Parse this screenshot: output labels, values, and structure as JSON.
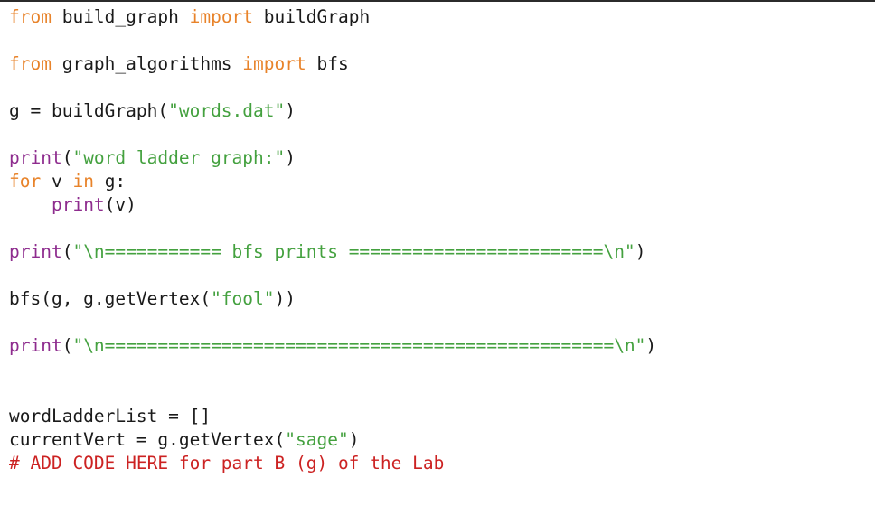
{
  "editor": {
    "name": "python-code-view",
    "language": "Python",
    "background_color": "#ffffff",
    "colors": {
      "keyword": "#e8832a",
      "builtin": "#8e2c8e",
      "string": "#44a13f",
      "comment": "#cc2222",
      "plain": "#1a1a1a",
      "border": "#2b2b2b"
    }
  },
  "code": {
    "lines": [
      {
        "index": 1,
        "text": "from build_graph import buildGraph",
        "tokens": [
          {
            "t": "from",
            "c": "kw"
          },
          {
            "t": " build_graph ",
            "c": "plain"
          },
          {
            "t": "import",
            "c": "kw"
          },
          {
            "t": " buildGraph",
            "c": "plain"
          }
        ]
      },
      {
        "index": 2,
        "text": "",
        "tokens": []
      },
      {
        "index": 3,
        "text": "from graph_algorithms import bfs",
        "tokens": [
          {
            "t": "from",
            "c": "kw"
          },
          {
            "t": " graph_algorithms ",
            "c": "plain"
          },
          {
            "t": "import",
            "c": "kw"
          },
          {
            "t": " bfs",
            "c": "plain"
          }
        ]
      },
      {
        "index": 4,
        "text": "",
        "tokens": []
      },
      {
        "index": 5,
        "text": "g = buildGraph(\"words.dat\")",
        "tokens": [
          {
            "t": "g = buildGraph(",
            "c": "plain"
          },
          {
            "t": "\"words.dat\"",
            "c": "str"
          },
          {
            "t": ")",
            "c": "plain"
          }
        ]
      },
      {
        "index": 6,
        "text": "",
        "tokens": []
      },
      {
        "index": 7,
        "text": "print(\"word ladder graph:\")",
        "tokens": [
          {
            "t": "print",
            "c": "builtin"
          },
          {
            "t": "(",
            "c": "plain"
          },
          {
            "t": "\"word ladder graph:\"",
            "c": "str"
          },
          {
            "t": ")",
            "c": "plain"
          }
        ]
      },
      {
        "index": 8,
        "text": "for v in g:",
        "tokens": [
          {
            "t": "for",
            "c": "kw"
          },
          {
            "t": " v ",
            "c": "plain"
          },
          {
            "t": "in",
            "c": "kw"
          },
          {
            "t": " g:",
            "c": "plain"
          }
        ]
      },
      {
        "index": 9,
        "text": "    print(v)",
        "tokens": [
          {
            "t": "    ",
            "c": "plain"
          },
          {
            "t": "print",
            "c": "builtin"
          },
          {
            "t": "(v)",
            "c": "plain"
          }
        ]
      },
      {
        "index": 10,
        "text": "",
        "tokens": []
      },
      {
        "index": 11,
        "text": "print(\"\\n=========== bfs prints ========================\\n\")",
        "tokens": [
          {
            "t": "print",
            "c": "builtin"
          },
          {
            "t": "(",
            "c": "plain"
          },
          {
            "t": "\"\\n=========== bfs prints ========================\\n\"",
            "c": "str"
          },
          {
            "t": ")",
            "c": "plain"
          }
        ]
      },
      {
        "index": 12,
        "text": "",
        "tokens": []
      },
      {
        "index": 13,
        "text": "bfs(g, g.getVertex(\"fool\"))",
        "tokens": [
          {
            "t": "bfs(g, g.getVertex(",
            "c": "plain"
          },
          {
            "t": "\"fool\"",
            "c": "str"
          },
          {
            "t": "))",
            "c": "plain"
          }
        ]
      },
      {
        "index": 14,
        "text": "",
        "tokens": []
      },
      {
        "index": 15,
        "text": "print(\"\\n================================================\\n\")",
        "tokens": [
          {
            "t": "print",
            "c": "builtin"
          },
          {
            "t": "(",
            "c": "plain"
          },
          {
            "t": "\"\\n================================================\\n\"",
            "c": "str"
          },
          {
            "t": ")",
            "c": "plain"
          }
        ]
      },
      {
        "index": 16,
        "text": "",
        "tokens": []
      },
      {
        "index": 17,
        "text": "",
        "tokens": []
      },
      {
        "index": 18,
        "text": "wordLadderList = []",
        "tokens": [
          {
            "t": "wordLadderList = []",
            "c": "plain"
          }
        ]
      },
      {
        "index": 19,
        "text": "currentVert = g.getVertex(\"sage\")",
        "tokens": [
          {
            "t": "currentVert = g.getVertex(",
            "c": "plain"
          },
          {
            "t": "\"sage\"",
            "c": "str"
          },
          {
            "t": ")",
            "c": "plain"
          }
        ]
      },
      {
        "index": 20,
        "text": "# ADD CODE HERE for part B (g) of the Lab",
        "tokens": [
          {
            "t": "# ADD CODE HERE for part B (g) of the Lab",
            "c": "comment"
          }
        ]
      }
    ]
  }
}
